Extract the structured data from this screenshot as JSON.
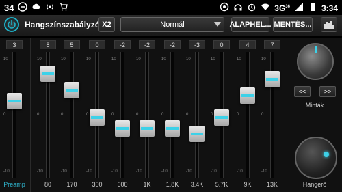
{
  "status": {
    "left_number": "34",
    "network": "3G",
    "network_sup": "36",
    "time": "3:34"
  },
  "toolbar": {
    "title": "Hangszínszabályzó",
    "x2_label": "X2",
    "preset_value": "Normál",
    "defaults_label": "ALAPHEL...",
    "save_label": "MENTÉS..."
  },
  "eq": {
    "tick_top": "10",
    "tick_mid": "0",
    "tick_bottom": "-10",
    "channels": [
      {
        "label": "Preamp",
        "value": "3",
        "level": 3
      },
      {
        "label": "80",
        "value": "8",
        "level": 8
      },
      {
        "label": "170",
        "value": "5",
        "level": 5
      },
      {
        "label": "300",
        "value": "0",
        "level": 0
      },
      {
        "label": "600",
        "value": "-2",
        "level": -2
      },
      {
        "label": "1K",
        "value": "-2",
        "level": -2
      },
      {
        "label": "1.8K",
        "value": "-2",
        "level": -2
      },
      {
        "label": "3.4K",
        "value": "-3",
        "level": -3
      },
      {
        "label": "5.7K",
        "value": "0",
        "level": 0
      },
      {
        "label": "9K",
        "value": "4",
        "level": 4
      },
      {
        "label": "13K",
        "value": "7",
        "level": 7
      }
    ]
  },
  "side": {
    "prev_label": "<<",
    "next_label": ">>",
    "presets_label": "Minták",
    "volume_label": "Hangerő"
  },
  "colors": {
    "accent": "#2fb3cc"
  }
}
